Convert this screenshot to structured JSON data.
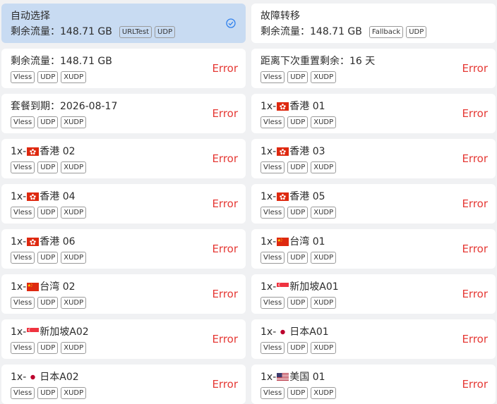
{
  "colors": {
    "error": "#e53935",
    "selected_bg": "#c8dbf2",
    "check": "#2f80ed"
  },
  "groups": [
    {
      "title": "自动选择",
      "info": "剩余流量：148.71 GB",
      "tags": [
        "URLTest",
        "UDP"
      ],
      "icon": "check-circle-icon"
    },
    {
      "title": "故障转移",
      "info": "剩余流量：148.71 GB",
      "tags": [
        "Fallback",
        "UDP"
      ]
    }
  ],
  "nodes": [
    {
      "prefix": "剩余流量：148.71 GB",
      "flag": "",
      "suffix": "",
      "tags": [
        "Vless",
        "UDP",
        "XUDP"
      ],
      "status": "Error"
    },
    {
      "prefix": "距离下次重置剩余：16 天",
      "flag": "",
      "suffix": "",
      "tags": [
        "Vless",
        "UDP",
        "XUDP"
      ],
      "status": "Error"
    },
    {
      "prefix": "套餐到期：2026-08-17",
      "flag": "",
      "suffix": "",
      "tags": [
        "Vless",
        "UDP",
        "XUDP"
      ],
      "status": "Error"
    },
    {
      "prefix": "1x-",
      "flag": "hk-flag-icon",
      "suffix": "香港 01",
      "tags": [
        "Vless",
        "UDP",
        "XUDP"
      ],
      "status": "Error"
    },
    {
      "prefix": "1x-",
      "flag": "hk-flag-icon",
      "suffix": "香港 02",
      "tags": [
        "Vless",
        "UDP",
        "XUDP"
      ],
      "status": "Error"
    },
    {
      "prefix": "1x-",
      "flag": "hk-flag-icon",
      "suffix": "香港 03",
      "tags": [
        "Vless",
        "UDP",
        "XUDP"
      ],
      "status": "Error"
    },
    {
      "prefix": "1x-",
      "flag": "hk-flag-icon",
      "suffix": "香港 04",
      "tags": [
        "Vless",
        "UDP",
        "XUDP"
      ],
      "status": "Error"
    },
    {
      "prefix": "1x-",
      "flag": "hk-flag-icon",
      "suffix": "香港 05",
      "tags": [
        "Vless",
        "UDP",
        "XUDP"
      ],
      "status": "Error"
    },
    {
      "prefix": "1x-",
      "flag": "hk-flag-icon",
      "suffix": "香港 06",
      "tags": [
        "Vless",
        "UDP",
        "XUDP"
      ],
      "status": "Error"
    },
    {
      "prefix": "1x-",
      "flag": "cn-flag-icon",
      "suffix": "台湾 01",
      "tags": [
        "Vless",
        "UDP",
        "XUDP"
      ],
      "status": "Error"
    },
    {
      "prefix": "1x-",
      "flag": "cn-flag-icon",
      "suffix": "台湾 02",
      "tags": [
        "Vless",
        "UDP",
        "XUDP"
      ],
      "status": "Error"
    },
    {
      "prefix": "1x-",
      "flag": "sg-flag-icon",
      "suffix": "新加坡A01",
      "tags": [
        "Vless",
        "UDP",
        "XUDP"
      ],
      "status": "Error"
    },
    {
      "prefix": "1x-",
      "flag": "sg-flag-icon",
      "suffix": "新加坡A02",
      "tags": [
        "Vless",
        "UDP",
        "XUDP"
      ],
      "status": "Error"
    },
    {
      "prefix": "1x-",
      "flag": "jp-flag-icon",
      "suffix": "日本A01",
      "tags": [
        "Vless",
        "UDP",
        "XUDP"
      ],
      "status": "Error"
    },
    {
      "prefix": "1x-",
      "flag": "jp-flag-icon",
      "suffix": "日本A02",
      "tags": [
        "Vless",
        "UDP",
        "XUDP"
      ],
      "status": "Error"
    },
    {
      "prefix": "1x-",
      "flag": "us-flag-icon",
      "suffix": "美国 01",
      "tags": [
        "Vless",
        "UDP",
        "XUDP"
      ],
      "status": "Error"
    }
  ]
}
